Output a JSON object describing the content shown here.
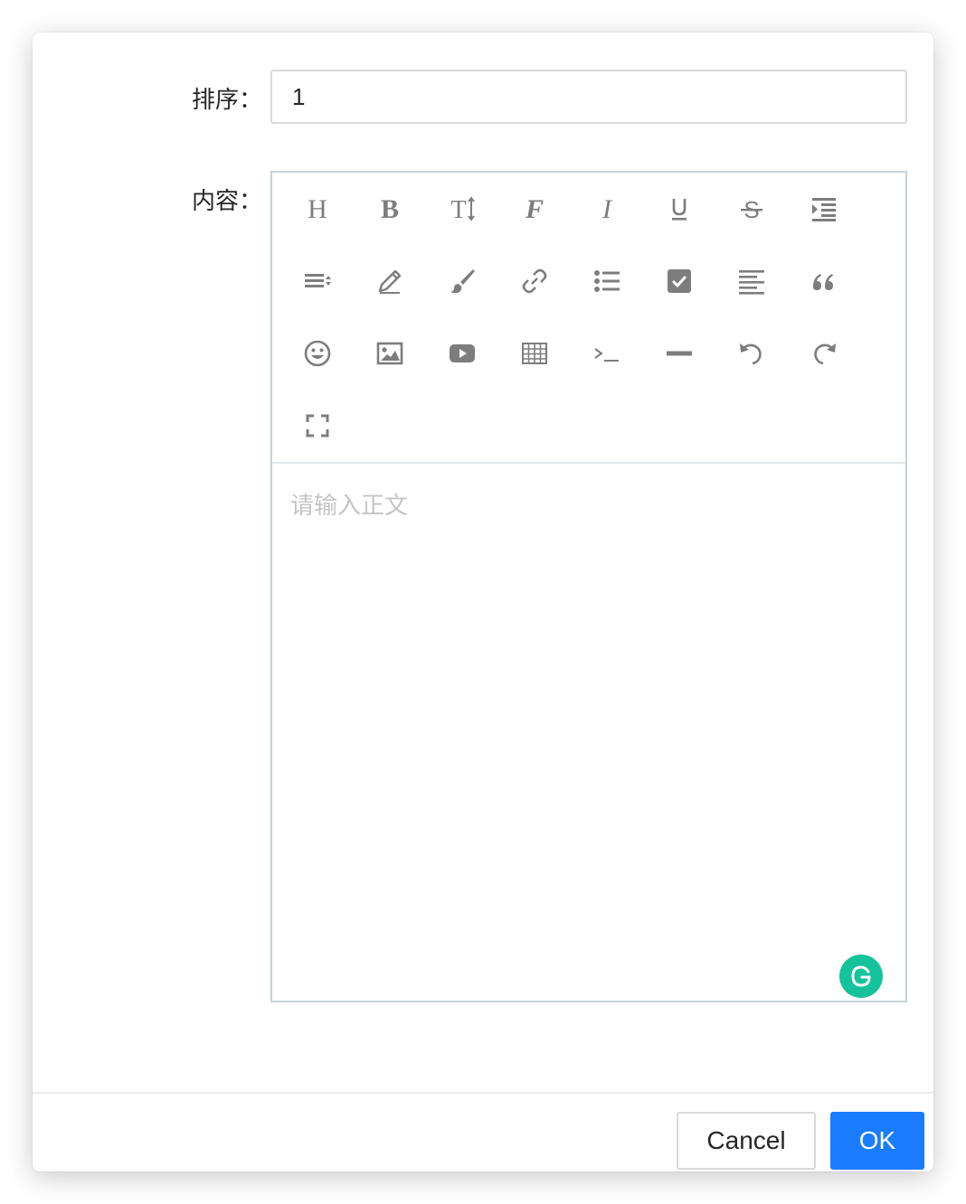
{
  "form": {
    "sort_label": "排序：",
    "sort_value": "1",
    "content_label": "内容："
  },
  "editor": {
    "placeholder": "请输入正文",
    "toolbar": [
      {
        "name": "heading-icon"
      },
      {
        "name": "bold-icon"
      },
      {
        "name": "font-size-icon"
      },
      {
        "name": "font-family-icon"
      },
      {
        "name": "italic-icon"
      },
      {
        "name": "underline-icon"
      },
      {
        "name": "strikethrough-icon"
      },
      {
        "name": "indent-icon"
      },
      {
        "name": "line-height-icon"
      },
      {
        "name": "pencil-icon"
      },
      {
        "name": "brush-icon"
      },
      {
        "name": "link-icon"
      },
      {
        "name": "list-icon"
      },
      {
        "name": "checkbox-icon"
      },
      {
        "name": "align-left-icon"
      },
      {
        "name": "quote-icon"
      },
      {
        "name": "emoji-icon"
      },
      {
        "name": "image-icon"
      },
      {
        "name": "video-icon"
      },
      {
        "name": "table-icon"
      },
      {
        "name": "code-icon"
      },
      {
        "name": "divider-icon"
      },
      {
        "name": "undo-icon"
      },
      {
        "name": "redo-icon"
      },
      {
        "name": "fullscreen-icon"
      }
    ],
    "grammarly_icon": "grammarly-icon"
  },
  "footer": {
    "cancel_label": "Cancel",
    "ok_label": "OK"
  },
  "colors": {
    "primary": "#1a7cff",
    "icon": "#7d7d7d",
    "grammarly": "#15c39a"
  }
}
